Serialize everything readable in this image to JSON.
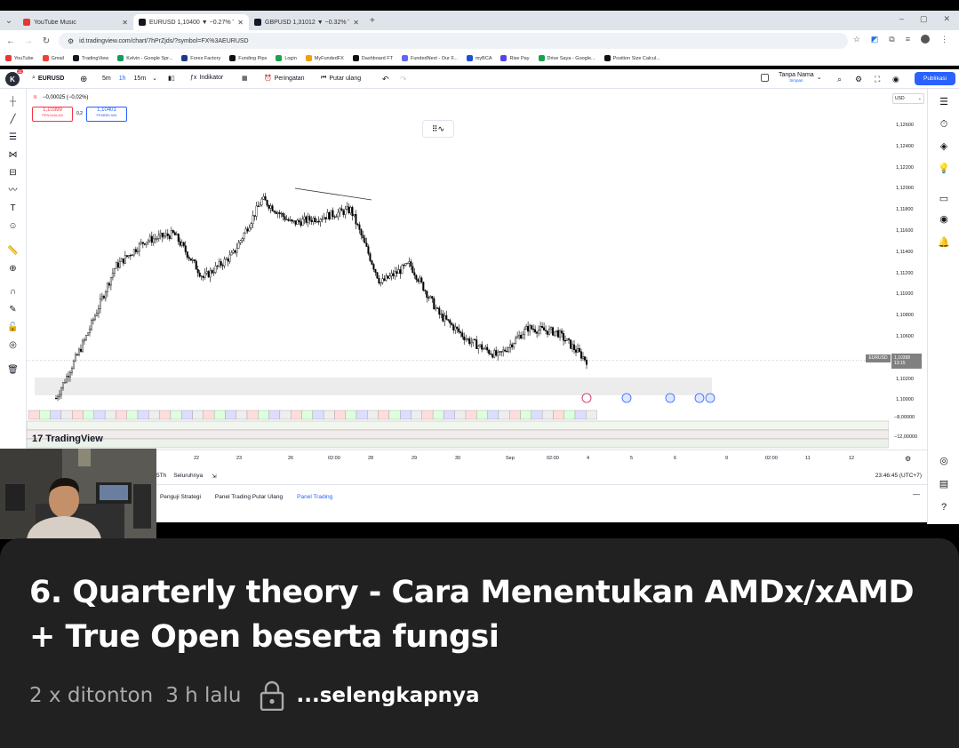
{
  "browser": {
    "tabs": [
      {
        "title": "YouTube Music",
        "color": "#e53935",
        "active": false
      },
      {
        "title": "EURUSD 1,10400 ▼ −0.27% Ta...",
        "color": "#131722",
        "active": true
      },
      {
        "title": "GBPUSD 1,31012 ▼ −0.32% Ta...",
        "color": "#131722",
        "active": false
      }
    ],
    "url": "id.tradingview.com/chart/7hPrZjds/?symbol=FX%3AEURUSD",
    "bookmarks": [
      {
        "label": "YouTube",
        "color": "#e53935"
      },
      {
        "label": "Gmail",
        "color": "#ea4335"
      },
      {
        "label": "TradingView",
        "color": "#131722"
      },
      {
        "label": "Kelvin - Google Spr...",
        "color": "#0f9d58"
      },
      {
        "label": "Forex Factory",
        "color": "#1e3a8a"
      },
      {
        "label": "Funding Pips",
        "color": "#111111"
      },
      {
        "label": "Login",
        "color": "#16a34a"
      },
      {
        "label": "MyFundedFX",
        "color": "#f59e0b"
      },
      {
        "label": "Dashboard FT",
        "color": "#111111"
      },
      {
        "label": "FundedNext - Our F...",
        "color": "#6366f1"
      },
      {
        "label": "myBCA",
        "color": "#1d4ed8"
      },
      {
        "label": "Rise Pay",
        "color": "#4f46e5"
      },
      {
        "label": "Drive Saya - Google...",
        "color": "#16a34a"
      },
      {
        "label": "Position Size Calcul...",
        "color": "#111111"
      }
    ]
  },
  "tv": {
    "logo_badge": "11",
    "symbol": "EURUSD",
    "intervals": [
      "5m",
      "1h",
      "15m"
    ],
    "indicator_label": "Indikator",
    "alert_label": "Peringatan",
    "replay_label": "Putar ulang",
    "layout_name": "Tanpa Nama",
    "layout_sub": "Simpan",
    "publish_label": "Publikasi",
    "change_text": "−0,00025 (−0,02%)",
    "sell_price": "1,10399",
    "sell_label": "PENJUALAN",
    "spread": "0,2",
    "buy_price": "1,10401",
    "buy_label": "PEMBELIAN",
    "currency": "USD",
    "price_ticks": [
      "1,12600",
      "1,12400",
      "1,12200",
      "1,12000",
      "1,11800",
      "1,11600",
      "1,11400",
      "1,11200",
      "1,11000",
      "1,10800",
      "1,10600",
      "1,10400",
      "1,10200",
      "1,10000"
    ],
    "sub_ticks": [
      "−8,00000",
      "−12,00000"
    ],
    "price_label": "1,10398",
    "price_label_time": "13:15",
    "symbol_tag": "EURUSD",
    "time_ticks": [
      "22",
      "23",
      "26",
      "02:00",
      "28",
      "29",
      "30",
      "Sep",
      "02:00",
      "4",
      "5",
      "6",
      "9",
      "02:00",
      "11",
      "12"
    ],
    "range_label": "5Th",
    "goto_label": "Seluruhnya",
    "clock": "23:46:45 (UTC+7)",
    "bottom_tabs": [
      "Penguji Strategi",
      "Panel Trading Putar Ulang",
      "Panel Trading"
    ],
    "watermark": "TradingView"
  },
  "chart_data": {
    "type": "candlestick",
    "symbol": "EURUSD",
    "y_unit": "price",
    "ylim": [
      1.0995,
      1.1275
    ],
    "x": [
      "22",
      "23",
      "26",
      "02:00",
      "28",
      "29",
      "30",
      "Sep",
      "02:00",
      "4"
    ],
    "series": [
      {
        "values": [
          1.1005,
          1.1062,
          1.113,
          1.1155,
          1.1162,
          1.112,
          1.1142,
          1.1195,
          1.1172,
          1.1178,
          1.1185,
          1.1115,
          1.1133,
          1.1085,
          1.106,
          1.1045,
          1.1072,
          1.1068,
          1.1041
        ]
      }
    ]
  },
  "youtube": {
    "title": "6. Quarterly theory - Cara Menentukan AMDx/xAMD + True Open beserta fungsi",
    "views": "2 x ditonton",
    "age": "3 h lalu",
    "more": "...selengkapnya"
  }
}
